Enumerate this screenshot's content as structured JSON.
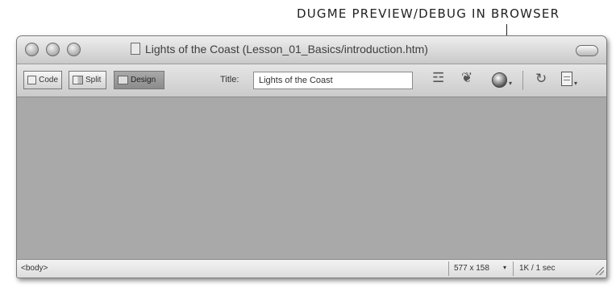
{
  "annotation": {
    "label": "DUGME PREVIEW/DEBUG IN BROWSER"
  },
  "window": {
    "title": "Lights of the Coast (Lesson_01_Basics/introduction.htm)"
  },
  "toolbar": {
    "views": [
      {
        "label": "Code",
        "icon": "code-view-icon",
        "active": false
      },
      {
        "label": "Split",
        "icon": "split-view-icon",
        "active": false
      },
      {
        "label": "Design",
        "icon": "design-view-icon",
        "active": true
      }
    ],
    "title_label": "Title:",
    "title_value": "Lights of the Coast",
    "tools": [
      "file-management-icon",
      "code-navigation-icon",
      "preview-debug-browser-icon",
      "refresh-icon",
      "view-options-icon"
    ]
  },
  "status": {
    "tag_selector": "<body>",
    "window_size": "577 x 158",
    "download_stats": "1K / 1 sec"
  }
}
